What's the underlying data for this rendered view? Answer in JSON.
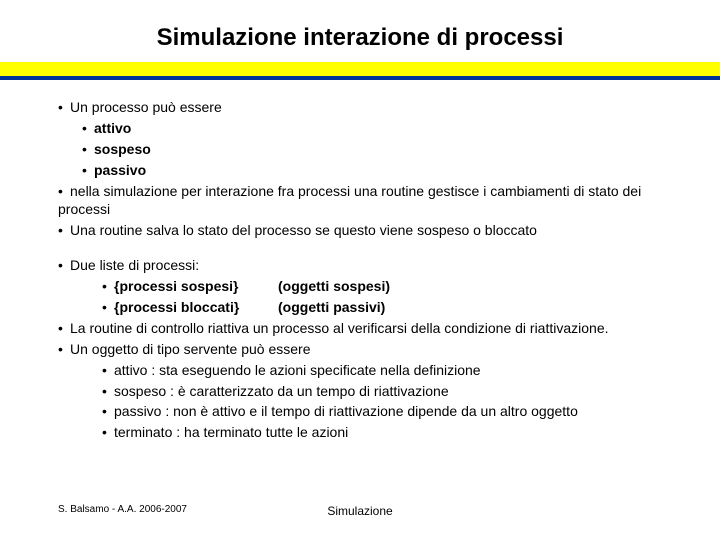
{
  "title": "Simulazione interazione di processi",
  "lines": {
    "l1": "Un processo può essere",
    "l1a": "attivo",
    "l1b": "sospeso",
    "l1c": "passivo",
    "l2": "nella simulazione per interazione fra processi una routine gestisce i cambiamenti di stato dei processi",
    "l3": "Una routine salva lo stato del processo se questo viene sospeso o bloccato",
    "l4": "Due liste di processi:",
    "l4a_left": "{processi sospesi}",
    "l4a_right": "(oggetti sospesi)",
    "l4b_left": "{processi bloccati}",
    "l4b_right": "(oggetti passivi)",
    "l5": "La routine di controllo riattiva un processo al verificarsi della condizione di riattivazione.",
    "l6": "Un oggetto di tipo servente può essere",
    "l6a": "attivo : sta eseguendo le azioni specificate nella definizione",
    "l6b": "sospeso : è caratterizzato da un tempo di riattivazione",
    "l6c": "passivo : non è attivo e il tempo di riattivazione dipende da un altro oggetto",
    "l6d": "terminato : ha terminato tutte le azioni"
  },
  "footer": {
    "left": "S. Balsamo - A.A. 2006-2007",
    "center": "Simulazione"
  }
}
